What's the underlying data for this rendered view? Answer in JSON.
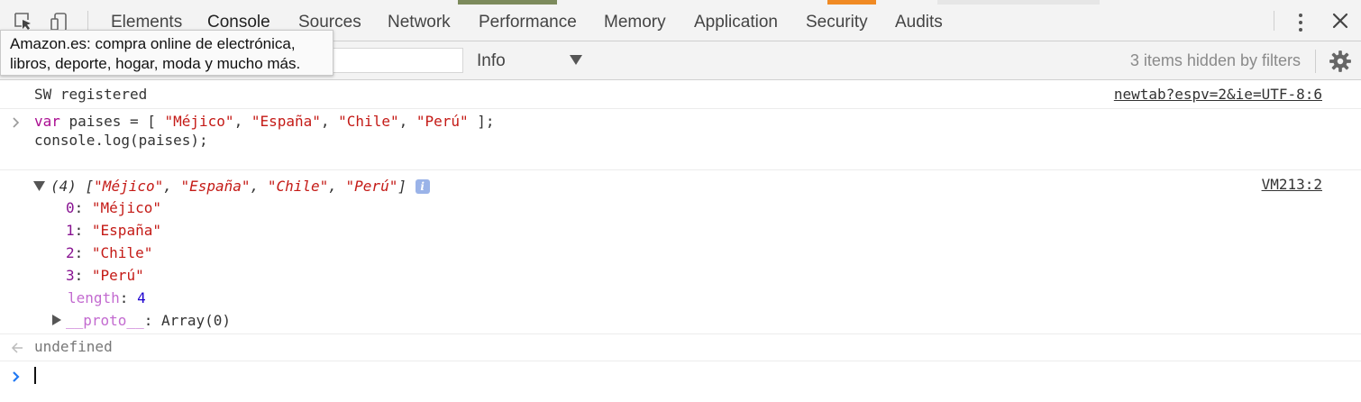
{
  "devtools": {
    "tabs": [
      {
        "label": "Elements"
      },
      {
        "label": "Console"
      },
      {
        "label": "Sources"
      },
      {
        "label": "Network"
      },
      {
        "label": "Performance"
      },
      {
        "label": "Memory"
      },
      {
        "label": "Application"
      },
      {
        "label": "Security"
      },
      {
        "label": "Audits"
      }
    ],
    "active_tab": "Console"
  },
  "filterbar": {
    "filter_value": "",
    "level_value": "Info",
    "hidden_count": "3 items hidden by filters"
  },
  "tooltip": {
    "line1": "Amazon.es: compra online de electrónica,",
    "line2": "libros, deporte, hogar, moda y mucho más."
  },
  "console": {
    "log1": {
      "text": "SW registered",
      "source": "newtab?espv=2&ie=UTF-8:6"
    },
    "input": {
      "kw": "var",
      "line1_a": " paises = [ ",
      "s1": "\"Méjico\"",
      "s2": "\"España\"",
      "s3": "\"Chile\"",
      "s4": "\"Perú\"",
      "comma": ", ",
      "line1_b": " ];",
      "line2": "console.log(paises);"
    },
    "array": {
      "summary_prefix": "(4) [",
      "summary_suffix": "]",
      "info_badge": "i",
      "source": "VM213:2",
      "items": [
        {
          "index": "0",
          "value": "\"Méjico\""
        },
        {
          "index": "1",
          "value": "\"España\""
        },
        {
          "index": "2",
          "value": "\"Chile\""
        },
        {
          "index": "3",
          "value": "\"Perú\""
        }
      ],
      "length_key": "length",
      "length_value": "4",
      "proto_key": "__proto__",
      "proto_value": "Array(0)"
    },
    "result": "undefined"
  },
  "colors": {
    "string": "#c41a16",
    "keyword": "#aa0d91",
    "prompt": "#2179f3"
  }
}
